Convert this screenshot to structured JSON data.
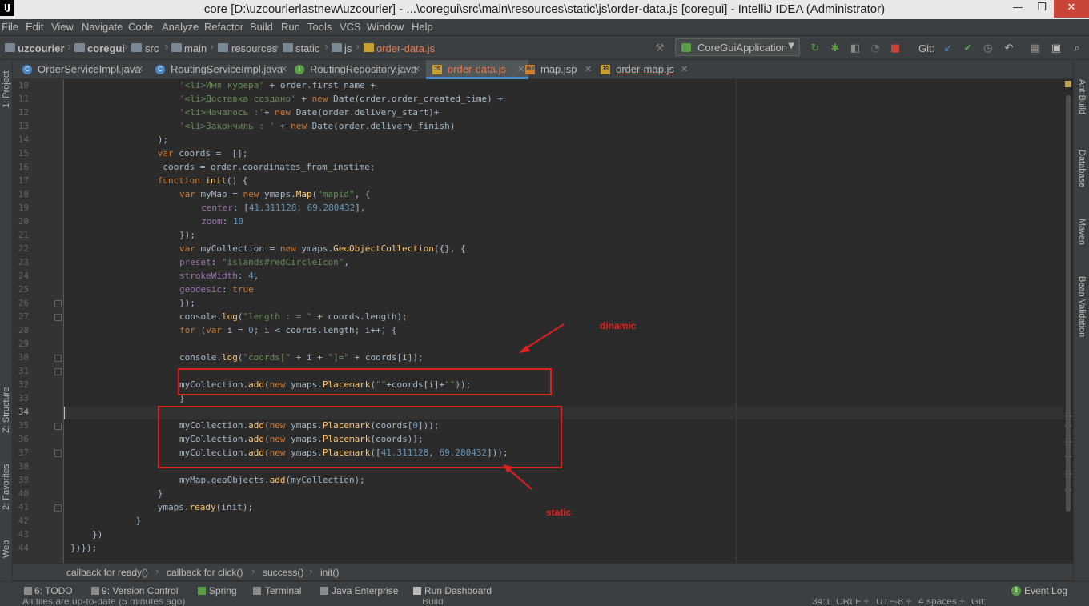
{
  "window": {
    "title": "core [D:\\uzcourierlastnew\\uzcourier] - ...\\coregui\\src\\main\\resources\\static\\js\\order-data.js [coregui] - IntelliJ IDEA (Administrator)",
    "app_icon": "IJ",
    "minimize": "—",
    "maximize": "❐",
    "close": "✕"
  },
  "menu": [
    "File",
    "Edit",
    "View",
    "Navigate",
    "Code",
    "Analyze",
    "Refactor",
    "Build",
    "Run",
    "Tools",
    "VCS",
    "Window",
    "Help"
  ],
  "breadcrumbs": [
    "uzcourier",
    "coregui",
    "src",
    "main",
    "resources",
    "static",
    "js",
    "order-data.js"
  ],
  "toolbar": {
    "run_config": "CoreGuiApplication",
    "git_label": "Git:"
  },
  "tabs": [
    {
      "label": "OrderServiceImpl.java",
      "icon": "C",
      "active": false
    },
    {
      "label": "RoutingServiceImpl.java",
      "icon": "C",
      "active": false
    },
    {
      "label": "RoutingRepository.java",
      "icon": "I",
      "active": false
    },
    {
      "label": "order-data.js",
      "icon": "JS",
      "active": true
    },
    {
      "label": "map.jsp",
      "icon": "JSP",
      "active": false
    },
    {
      "label": "order-map.js",
      "icon": "JS",
      "active": false
    }
  ],
  "left_tool_tabs": [
    "1: Project",
    "Z: Structure",
    "2: Favorites",
    "Web"
  ],
  "right_tool_tabs": [
    "Ant Build",
    "Database",
    "Maven",
    "Bean Validation"
  ],
  "editor": {
    "line_numbers": [
      "10",
      "11",
      "12",
      "13",
      "14",
      "15",
      "16",
      "17",
      "18",
      "19",
      "20",
      "21",
      "22",
      "23",
      "24",
      "25",
      "26",
      "27",
      "28",
      "29",
      "30",
      "31",
      "32",
      "33",
      "34",
      "35",
      "36",
      "37",
      "38",
      "39",
      "40",
      "41",
      "42",
      "43",
      "44"
    ],
    "current_line": "34",
    "lines": [
      {
        "n": "10",
        "text": "'<li>Имя курера' + order.first_name +"
      },
      {
        "n": "11",
        "text": "'<li>Доставка создано' + new Date(order.order_created_time) +"
      },
      {
        "n": "12",
        "text": "'<li>Началось :'+ new Date(order.delivery_start)+"
      },
      {
        "n": "13",
        "text": "'<li>Закончиль : ' + new Date(order.delivery_finish)"
      },
      {
        "n": "14",
        "text": ");"
      },
      {
        "n": "15",
        "text": "var coords =  [];"
      },
      {
        "n": "16",
        "text": " coords = order.coordinates_from_instime;"
      },
      {
        "n": "17",
        "text": "function init() {"
      },
      {
        "n": "18",
        "text": "var myMap = new ymaps.Map(\"mapid\", {"
      },
      {
        "n": "19",
        "text": "center: [41.311128, 69.280432],"
      },
      {
        "n": "20",
        "text": "zoom: 10"
      },
      {
        "n": "21",
        "text": "});"
      },
      {
        "n": "22",
        "text": "var myCollection = new ymaps.GeoObjectCollection({}, {"
      },
      {
        "n": "23",
        "text": "preset: \"islands#redCircleIcon\","
      },
      {
        "n": "24",
        "text": "strokeWidth: 4,"
      },
      {
        "n": "25",
        "text": "geodesic: true"
      },
      {
        "n": "26",
        "text": "});"
      },
      {
        "n": "27",
        "text": "console.log(\"length : = \" + coords.length);"
      },
      {
        "n": "28",
        "text": "for (var i = 0; i < coords.length; i++) {"
      },
      {
        "n": "29",
        "text": ""
      },
      {
        "n": "30",
        "text": "console.log(\"coords[\" + i + \"]=\" + coords[i]);"
      },
      {
        "n": "31",
        "text": ""
      },
      {
        "n": "32",
        "text": "myCollection.add(new ymaps.Placemark(\"\"+coords[i]+\"\"));"
      },
      {
        "n": "33",
        "text": "}"
      },
      {
        "n": "34",
        "text": ""
      },
      {
        "n": "35",
        "text": "myCollection.add(new ymaps.Placemark(coords[0]));"
      },
      {
        "n": "36",
        "text": "myCollection.add(new ymaps.Placemark(coords));"
      },
      {
        "n": "37",
        "text": "myCollection.add(new ymaps.Placemark([41.311128, 69.280432]));"
      },
      {
        "n": "38",
        "text": ""
      },
      {
        "n": "39",
        "text": "myMap.geoObjects.add(myCollection);"
      },
      {
        "n": "40",
        "text": "}"
      },
      {
        "n": "41",
        "text": "ymaps.ready(init);"
      },
      {
        "n": "42",
        "text": "}"
      },
      {
        "n": "43",
        "text": "})"
      },
      {
        "n": "44",
        "text": "})});"
      }
    ]
  },
  "annotations": {
    "dynamic_label": "dinamic",
    "static_label": "static",
    "accent_color": "#e02020"
  },
  "code_breadcrumb": [
    "callback for ready()",
    "callback for click()",
    "success()",
    "init()"
  ],
  "bottom_tabs": [
    "6: TODO",
    "9: Version Control",
    "Spring",
    "Terminal",
    "Java Enterprise",
    "Run Dashboard",
    "Event Log"
  ],
  "status": {
    "message": "All files are up-to-date (5 minutes ago)",
    "build": "Build",
    "position": "34:1",
    "line_sep": "CRLF ÷",
    "encoding": "UTF-8 ÷",
    "indent": "4 spaces ÷",
    "git": "Git:",
    "event_count": "1"
  },
  "colors": {
    "keyword": "#cc7832",
    "string": "#6a8759",
    "number": "#6897bb",
    "property": "#9876aa",
    "function": "#ffc66d",
    "text": "#a9b7c6",
    "background": "#2b2b2b"
  }
}
